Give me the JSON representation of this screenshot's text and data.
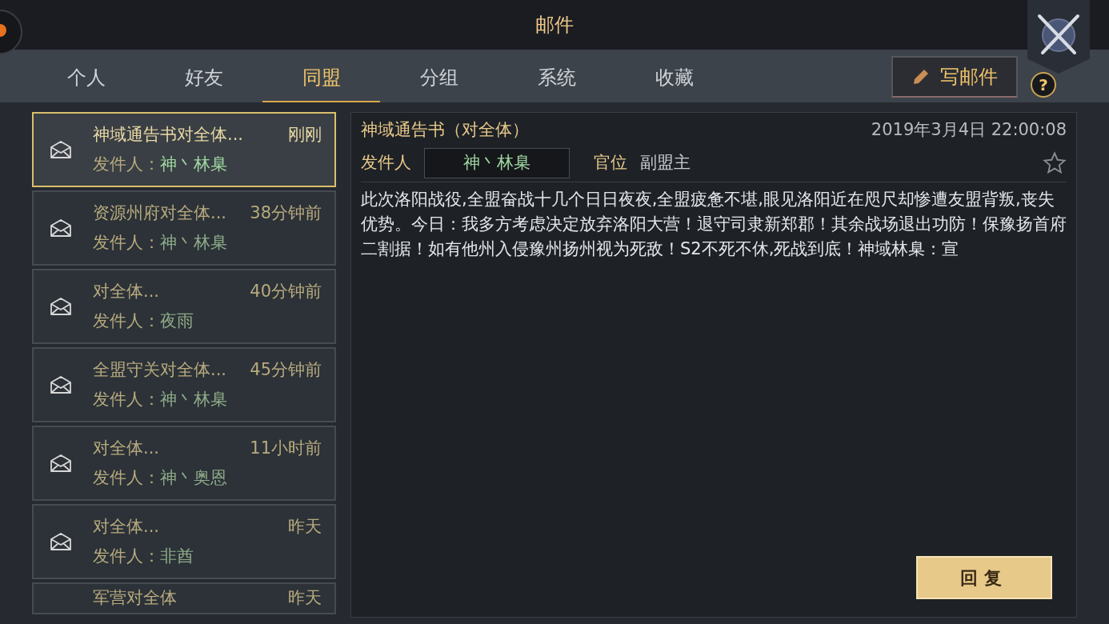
{
  "window": {
    "title": "邮件"
  },
  "tabs": [
    {
      "label": "个人",
      "selected": false
    },
    {
      "label": "好友",
      "selected": false
    },
    {
      "label": "同盟",
      "selected": true
    },
    {
      "label": "分组",
      "selected": false
    },
    {
      "label": "系统",
      "selected": false
    },
    {
      "label": "收藏",
      "selected": false
    }
  ],
  "compose_button": {
    "label": "写邮件"
  },
  "help_button": {
    "label": "?"
  },
  "mails": [
    {
      "subject": "神域通告书对全体...",
      "time": "刚刚",
      "sender_label": "发件人：",
      "sender": "神丶林臬",
      "selected": true
    },
    {
      "subject": "资源州府对全体...",
      "time": "38分钟前",
      "sender_label": "发件人：",
      "sender": "神丶林臬",
      "selected": false
    },
    {
      "subject": "对全体...",
      "time": "40分钟前",
      "sender_label": "发件人：",
      "sender": "夜雨",
      "selected": false
    },
    {
      "subject": "全盟守关对全体...",
      "time": "45分钟前",
      "sender_label": "发件人：",
      "sender": "神丶林臬",
      "selected": false
    },
    {
      "subject": "对全体...",
      "time": "11小时前",
      "sender_label": "发件人：",
      "sender": "神丶奥恩",
      "selected": false
    },
    {
      "subject": "对全体...",
      "time": "昨天",
      "sender_label": "发件人：",
      "sender": "非酋",
      "selected": false
    },
    {
      "subject": "军营对全体",
      "time": "昨天",
      "selected": false
    }
  ],
  "message": {
    "title": "神域通告书（对全体）",
    "date": "2019年3月4日 22:00:08",
    "sender_label": "发件人",
    "sender": "神丶林臬",
    "rank_label": "官位",
    "rank": "副盟主",
    "favorite": false,
    "body": "此次洛阳战役,全盟奋战十几个日日夜夜,全盟疲惫不堪,眼见洛阳近在咫尺却惨遭友盟背叛,丧失优势。今日：我多方考虑决定放弃洛阳大营！退守司隶新郑郡！其余战场退出功防！保豫扬首府二割据！如有他州入侵豫州扬州视为死敌！S2不死不休,死战到底！神域林臬：宣",
    "reply_button": "回复"
  }
}
